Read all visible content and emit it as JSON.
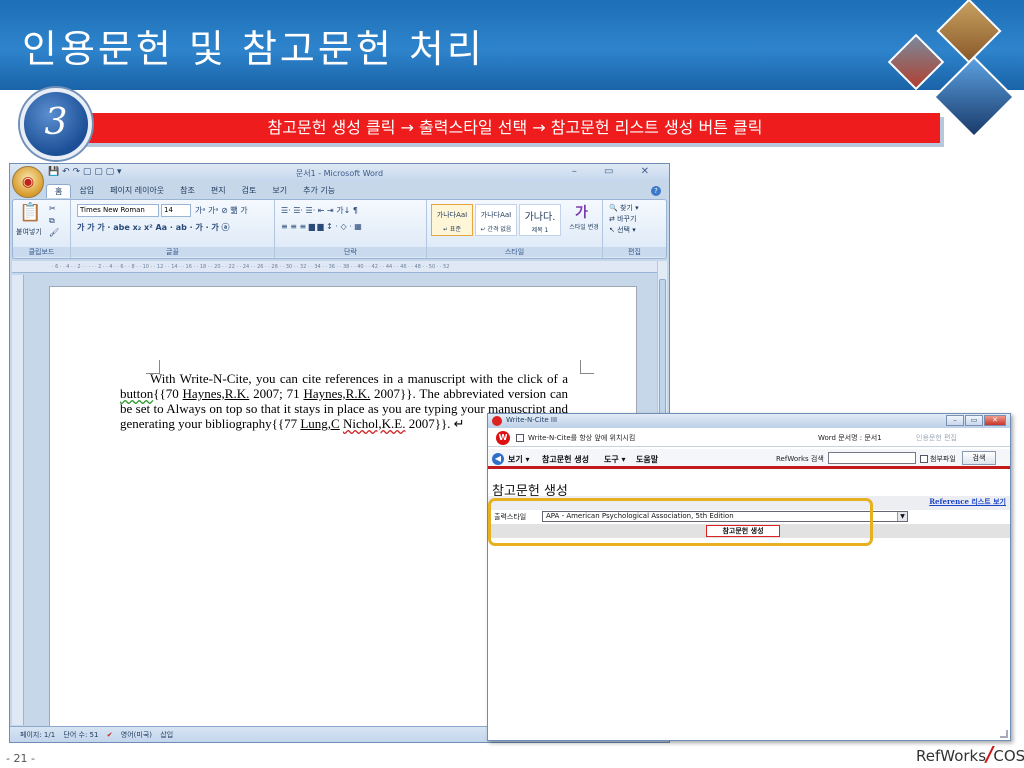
{
  "slide": {
    "title": "인용문헌 및 참고문헌 처리",
    "step_number": "3",
    "step_instruction": "참고문헌 생성 클릭 → 출력스타일 선택 → 참고문헌 리스트 생성 버튼 클릭",
    "page_number": "- 21 -",
    "logo_left": "RefWorks",
    "logo_right": "COS"
  },
  "word": {
    "window_title": "문서1 - Microsoft Word",
    "tabs": [
      "홈",
      "삽입",
      "페이지 레이아웃",
      "참조",
      "편지",
      "검토",
      "보기",
      "추가 기능"
    ],
    "font_name": "Times New Roman",
    "font_size": "14",
    "paste_label": "붙여넣기",
    "style_tiles": [
      {
        "preview": "가나다AaI",
        "label": "↵ 표준"
      },
      {
        "preview": "가나다AaI",
        "label": "↵ 간격 없음"
      },
      {
        "preview": "가나다.",
        "label": "제목 1"
      }
    ],
    "style_change_label": "스타일 변경",
    "edit_items": [
      "찾기",
      "바꾸기",
      "선택"
    ],
    "ribbon_groups": [
      "클립보드",
      "글꼴",
      "단락",
      "스타일",
      "편집"
    ],
    "document_text": {
      "p1": "With Write-N-Cite, you can cite references in a manuscript with the click of a",
      "w_button": "button",
      "c1": "{{70 ",
      "n1": "Haynes,R.K.",
      "c2": " 2007; 71 ",
      "n2": "Haynes,R.K.",
      "c3": " 2007}}. The abbreviated version can be set to Always on top so that it stays in place as you are typing your manuscript and generating your bibliography{{77 ",
      "n3": "Lung,C",
      "c4": "",
      "n4": "Nichol,K.E.",
      "c5": " 2007}}. ↵"
    },
    "status_bar": [
      "페이지: 1/1",
      "단어 수: 51",
      "영어(미국)",
      "삽입"
    ]
  },
  "wnc": {
    "window_title": "Write-N-Cite III",
    "always_on_top": "Write-N-Cite를 항상 앞에 위치시킴",
    "doc_name": "Word 문서명 : 문서1",
    "edit_citation": "인용문헌 편집",
    "menu": [
      "보기 ▾",
      "참고문헌 생성",
      "도구 ▾",
      "도움말"
    ],
    "search_label": "RefWorks 검색",
    "search_value": "",
    "attach_label": "첨부파일",
    "search_button": "검색",
    "heading": "참고문헌 생성",
    "reference_list_link": "Reference 리스트 보기",
    "output_style_label": "출력스타일",
    "output_style_value": "APA - American Psychological Association, 5th Edition",
    "generate_button": "참고문헌 생성"
  },
  "colors": {
    "header_blue": "#1d6fb7",
    "banner_red": "#ee1c1c",
    "highlight_orange": "#e7b020",
    "link_blue": "#1a44c8"
  }
}
